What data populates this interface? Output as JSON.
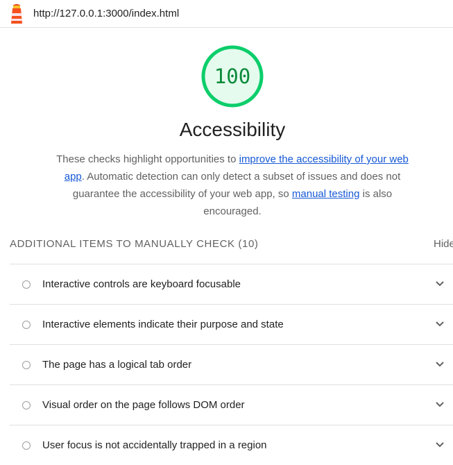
{
  "header": {
    "url": "http://127.0.0.1:3000/index.html"
  },
  "gauge": {
    "score": "100",
    "color": "#0cce6b"
  },
  "category": {
    "title": "Accessibility",
    "description_part1": "These checks highlight opportunities to ",
    "link1": "improve the accessibility of your web app",
    "description_part2": ". Automatic detection can only detect a subset of issues and does not guarantee the accessibility of your web app, so ",
    "link2": "manual testing",
    "description_part3": " is also encouraged."
  },
  "manual_section": {
    "header": "Additional items to manually check (10)",
    "toggle_label": "Hide",
    "items": [
      {
        "label": "Interactive controls are keyboard focusable"
      },
      {
        "label": "Interactive elements indicate their purpose and state"
      },
      {
        "label": "The page has a logical tab order"
      },
      {
        "label": "Visual order on the page follows DOM order"
      },
      {
        "label": "User focus is not accidentally trapped in a region"
      }
    ]
  }
}
